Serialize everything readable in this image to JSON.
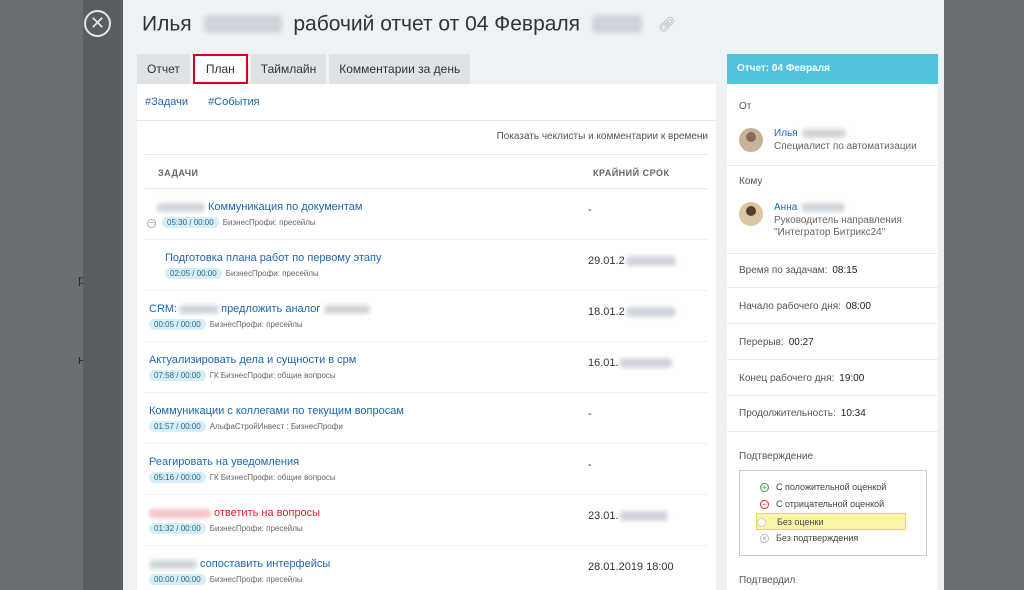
{
  "background": {
    "fragments": [
      "ран",
      "",
      "н"
    ]
  },
  "close_label": "✕",
  "title": {
    "first_name": "Илья",
    "rest": "рабочий отчет от 04 Февраля",
    "link_icon": "link-icon"
  },
  "tabs": [
    {
      "label": "Отчет"
    },
    {
      "label": "План"
    },
    {
      "label": "Таймлайн"
    },
    {
      "label": "Комментарии за день"
    }
  ],
  "subtabs": [
    {
      "label": "#Задачи"
    },
    {
      "label": "#События"
    }
  ],
  "show_link": "Показать чеклисты и комментарии к времени",
  "table": {
    "col_tasks": "ЗАДАЧИ",
    "col_deadline": "КРАЙНИЙ СРОК",
    "rows": [
      {
        "title": "Коммуникация по документам",
        "time": "05:30 / 00:00",
        "project": "БизнесПрофи: пресейлы",
        "deadline": "-"
      },
      {
        "title": "Подготовка плана работ по первому этапу",
        "time": "02:05 / 00:00",
        "project": "БизнесПрофи: пресейлы",
        "deadline": "29.01.2"
      },
      {
        "title_pre": "CRM:",
        "title": "предложить аналог",
        "time": "00:05 / 00:00",
        "project": "БизнесПрофи: пресейлы",
        "deadline": "18.01.2"
      },
      {
        "title": "Актуализировать дела и сущности в срм",
        "time": "07:58 / 00:00",
        "project": "ГК БизнесПрофи: общие вопросы",
        "deadline": "16.01."
      },
      {
        "title": "Коммуникации с коллегами по текущим вопросам",
        "time": "01:57 / 00:00",
        "project": "АльфаСтройИнвест : БизнесПрофи",
        "deadline": "-"
      },
      {
        "title": "Реагировать на уведомления",
        "time": "05:16 / 00:00",
        "project": "ГК БизнесПрофи: общие вопросы",
        "deadline": "-"
      },
      {
        "title": "ответить на вопросы",
        "time": "01:32 / 00:00",
        "project": "БизнесПрофи: пресейлы",
        "deadline": "23.01."
      },
      {
        "title": "сопоставить интерфейсы",
        "time": "00:00 / 00:00",
        "project": "БизнесПрофи: пресейлы",
        "deadline": "28.01.2019 18:00"
      }
    ]
  },
  "side": {
    "header": "Отчет: 04 Февраля",
    "from_label": "От",
    "from_name": "Илья",
    "from_role": "Специалист по автоматизации",
    "to_label": "Кому",
    "to_name": "Анна",
    "to_role_1": "Руководитель направления",
    "to_role_2": "\"Интегратор Битрикс24\"",
    "stats": [
      {
        "label": "Время по задачам:",
        "value": "08:15"
      },
      {
        "label": "Начало рабочего дня:",
        "value": "08:00"
      },
      {
        "label": "Перерыв:",
        "value": "00:27"
      },
      {
        "label": "Конец рабочего дня:",
        "value": "19:00"
      },
      {
        "label": "Продолжительность:",
        "value": "10:34"
      }
    ],
    "confirm_label": "Подтверждение",
    "options": [
      {
        "label": "С положительной оценкой",
        "icon": "plus-icon"
      },
      {
        "label": "С отрицательной оценкой",
        "icon": "minus-icon"
      },
      {
        "label": "Без оценки",
        "icon": "empty-circle-icon"
      },
      {
        "label": "Без подтверждения",
        "icon": "x-icon"
      }
    ],
    "confirmed_by_label": "Подтвердил"
  }
}
